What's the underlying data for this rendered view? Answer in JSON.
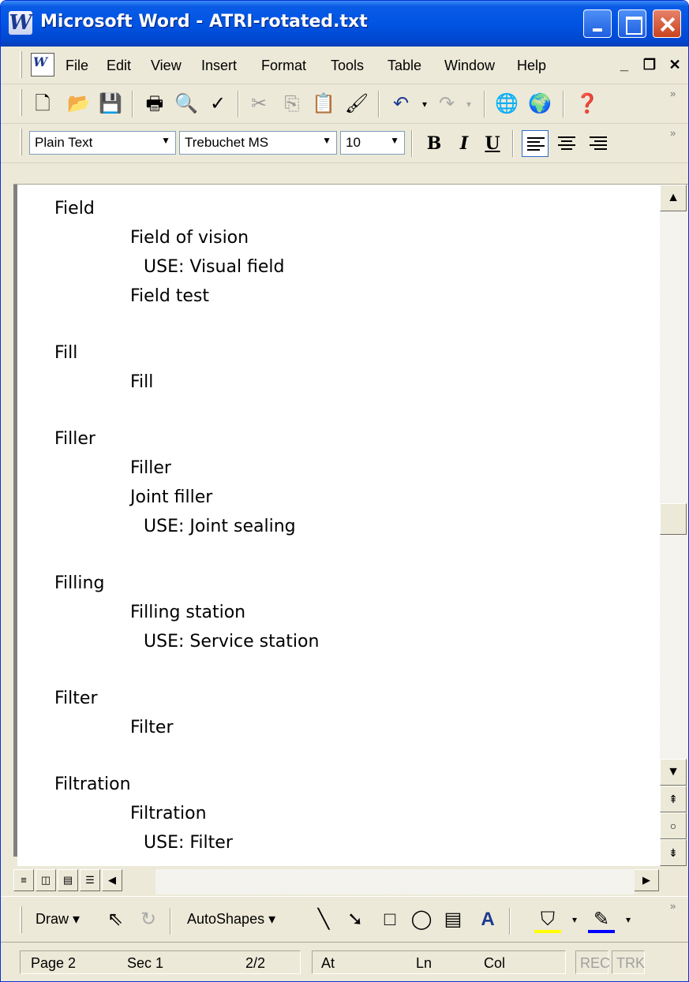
{
  "window": {
    "title": "Microsoft Word - ATRI-rotated.txt",
    "app_icon": "W"
  },
  "menu": {
    "items": [
      {
        "label": "File"
      },
      {
        "label": "Edit"
      },
      {
        "label": "View"
      },
      {
        "label": "Insert"
      },
      {
        "label": "Format"
      },
      {
        "label": "Tools"
      },
      {
        "label": "Table"
      },
      {
        "label": "Window"
      },
      {
        "label": "Help"
      }
    ],
    "mdi": {
      "minimize": "_",
      "restore": "❐",
      "close": "✕"
    }
  },
  "format_toolbar": {
    "style": "Plain Text",
    "font": "Trebuchet MS",
    "size": "10",
    "bold": "B",
    "italic": "I",
    "underline": "U"
  },
  "document": {
    "lines": [
      {
        "indent": 0,
        "text": "Field"
      },
      {
        "indent": 1,
        "text": "Field of vision"
      },
      {
        "indent": 2,
        "text": "USE: Visual field"
      },
      {
        "indent": 1,
        "text": "Field test"
      },
      {
        "indent": 0,
        "text": "Fill"
      },
      {
        "indent": 1,
        "text": "Fill"
      },
      {
        "indent": 0,
        "text": "Filler"
      },
      {
        "indent": 1,
        "text": "Filler"
      },
      {
        "indent": 1,
        "text": "Joint filler"
      },
      {
        "indent": 2,
        "text": "USE: Joint sealing"
      },
      {
        "indent": 0,
        "text": "Filling"
      },
      {
        "indent": 1,
        "text": "Filling station"
      },
      {
        "indent": 2,
        "text": "USE: Service station"
      },
      {
        "indent": 0,
        "text": "Filter"
      },
      {
        "indent": 1,
        "text": "Filter"
      },
      {
        "indent": 0,
        "text": "Filtration"
      },
      {
        "indent": 1,
        "text": "Filtration"
      },
      {
        "indent": 2,
        "text": "USE: Filter"
      }
    ]
  },
  "drawing_toolbar": {
    "draw": "Draw",
    "autoshapes": "AutoShapes"
  },
  "status": {
    "page": "Page 2",
    "sec": "Sec 1",
    "pages": "2/2",
    "at": "At",
    "ln": "Ln",
    "col": "Col",
    "rec": "REC",
    "trk": "TRK"
  },
  "colors": {
    "titlebar": "#0054e3",
    "chrome": "#ece9d8",
    "close_button": "#c8431e"
  }
}
